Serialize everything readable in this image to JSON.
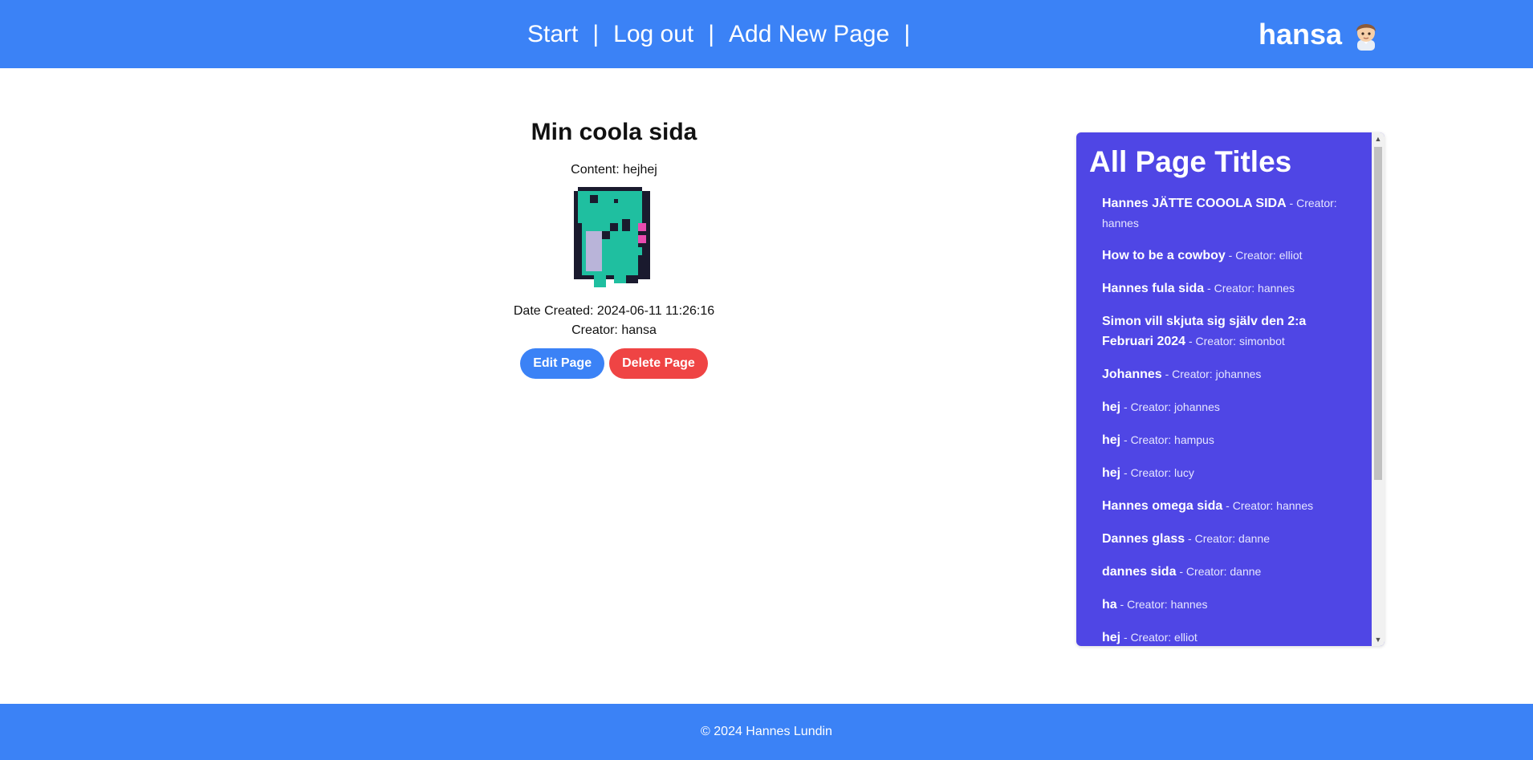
{
  "nav": {
    "items": [
      "Start",
      "Log out",
      "Add New Page"
    ],
    "separator": "|",
    "username": "hansa",
    "avatar_icon": "boy-avatar-icon"
  },
  "page": {
    "title": "Min coola sida",
    "content": "Content: hejhej",
    "image_icon": "pixel-dinosaur-image",
    "date_created": "Date Created: 2024-06-11 11:26:16",
    "creator": "Creator: hansa",
    "edit_label": "Edit Page",
    "delete_label": "Delete Page"
  },
  "sidebar": {
    "title": "All Page Titles",
    "items": [
      {
        "title": "Hannes JÄTTE COOOLA SIDA",
        "by": " - Creator: hannes"
      },
      {
        "title": "How to be a cowboy",
        "by": " - Creator: elliot"
      },
      {
        "title": "Hannes fula sida",
        "by": " - Creator: hannes"
      },
      {
        "title": "Simon vill skjuta sig själv den 2:a Februari 2024",
        "by": " - Creator: simonbot"
      },
      {
        "title": "Johannes",
        "by": " - Creator: johannes"
      },
      {
        "title": "hej",
        "by": " - Creator: johannes"
      },
      {
        "title": "hej",
        "by": " - Creator: hampus"
      },
      {
        "title": "hej",
        "by": " - Creator: lucy"
      },
      {
        "title": "Hannes omega sida",
        "by": " - Creator: hannes"
      },
      {
        "title": "Dannes glass",
        "by": " - Creator: danne"
      },
      {
        "title": "dannes sida",
        "by": " - Creator: danne"
      },
      {
        "title": "ha",
        "by": " - Creator: hannes"
      },
      {
        "title": "hej",
        "by": " - Creator: elliot"
      }
    ]
  },
  "footer": {
    "text": "© 2024 Hannes Lundin"
  },
  "colors": {
    "brand": "#3b82f6",
    "panel": "#4f46e5",
    "danger": "#ef4444"
  }
}
